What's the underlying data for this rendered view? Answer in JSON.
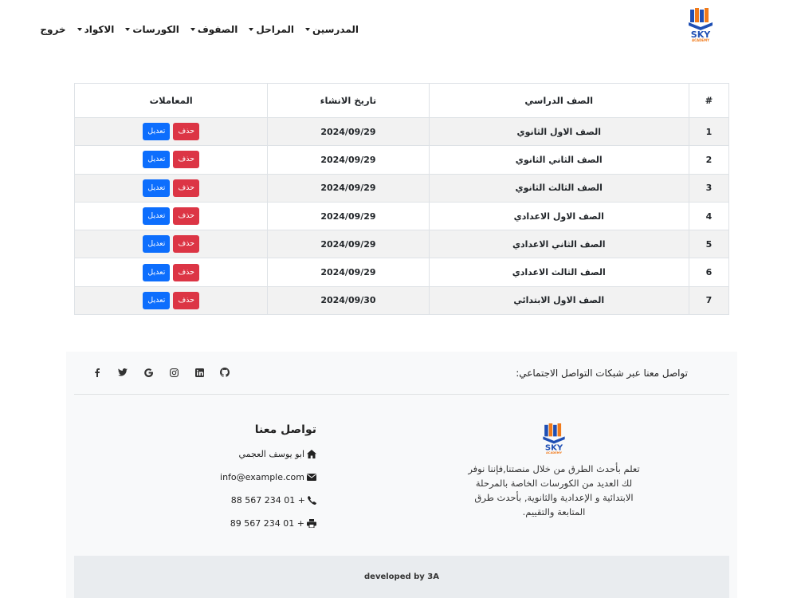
{
  "nav": {
    "items": [
      {
        "label": "المدرسين",
        "dropdown": true
      },
      {
        "label": "المراحل",
        "dropdown": true
      },
      {
        "label": "الصفوف",
        "dropdown": true
      },
      {
        "label": "الكورسات",
        "dropdown": true
      },
      {
        "label": "الاكواد",
        "dropdown": true
      },
      {
        "label": "خروج",
        "dropdown": false
      }
    ],
    "logo_text": "SKY",
    "logo_subtext": "ACADEMY"
  },
  "table": {
    "headers": {
      "num": "#",
      "grade": "الصف الدراسي",
      "date": "تاريخ الانشاء",
      "actions": "المعاملات"
    },
    "delete_label": "حذف",
    "edit_label": "تعديل",
    "rows": [
      {
        "num": "1",
        "grade": "الصف الاول الثانوي",
        "date": "2024/09/29"
      },
      {
        "num": "2",
        "grade": "الصف الثاني الثانوي",
        "date": "2024/09/29"
      },
      {
        "num": "3",
        "grade": "الصف الثالث الثانوي",
        "date": "2024/09/29"
      },
      {
        "num": "4",
        "grade": "الصف الاول الاعدادي",
        "date": "2024/09/29"
      },
      {
        "num": "5",
        "grade": "الصف الثاني الاعدادي",
        "date": "2024/09/29"
      },
      {
        "num": "6",
        "grade": "الصف الثالث الاعدادي",
        "date": "2024/09/29"
      },
      {
        "num": "7",
        "grade": "الصف الاول الابتدائي",
        "date": "2024/09/30"
      }
    ]
  },
  "footer": {
    "social_text": "تواصل معنا عبر شبكات التواصل الاجتماعي:",
    "about_text": "تعلم بأحدث الطرق من خلال منصتنا,فإننا نوفر لك العديد من الكورسات الخاصة بالمرحلة الابتدائية و الإعدادية والثانوية, بأحدث طرق المتابعة والتقييم.",
    "contact_title": "تواصل معنا",
    "contact_name": "ابو يوسف العجمي",
    "contact_email": "info@example.com",
    "contact_phone": "+ 01 234 567 88",
    "contact_fax": "+ 01 234 567 89",
    "credit": "developed by 3A",
    "social_icons": [
      "facebook-icon",
      "twitter-icon",
      "google-icon",
      "instagram-icon",
      "linkedin-icon",
      "github-icon"
    ]
  },
  "colors": {
    "edit": "#0d6efd",
    "delete": "#dc3545",
    "logo_blue": "#1f4fb4",
    "logo_orange": "#f07a1a"
  }
}
